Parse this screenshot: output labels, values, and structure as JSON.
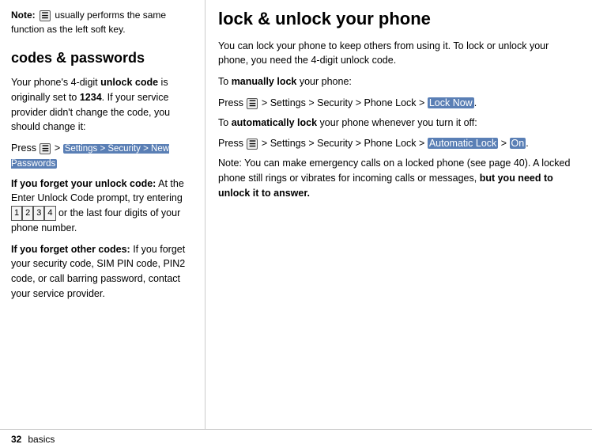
{
  "left": {
    "note": {
      "label": "Note:",
      "text": " usually performs the same function as the left soft key."
    },
    "section_title": "codes & passwords",
    "intro": "Your phone's 4-digit ",
    "intro_bold": "unlock code",
    "intro2": " is originally set to ",
    "intro2_bold": "1234",
    "intro3": ". If your service provider didn't change the code, you should change it:",
    "press_label": "Press",
    "menu_icon": "☰",
    "menu_path": "Settings > Security > New Passwords",
    "forget_code_label": "If you forget your unlock code:",
    "forget_code_text": " At the Enter Unlock Code prompt, try entering ",
    "digits": [
      "1",
      "2",
      "3",
      "4"
    ],
    "forget_code_text2": " or the last four digits of your phone number.",
    "forget_other_label": "If you forget other codes:",
    "forget_other_text": " If you forget your security code, SIM PIN code, PIN2 code, or call barring password, contact your service provider."
  },
  "right": {
    "title": "lock & unlock your phone",
    "intro": "You can lock your phone to keep others from using it. To lock or unlock your phone, you need the 4-digit unlock code.",
    "manual_lock_intro": "To ",
    "manual_lock_bold": "manually lock",
    "manual_lock_intro2": " your phone:",
    "press_label1": "Press",
    "menu_icon1": "☰",
    "menu_path1_pre": "Settings > Security > Phone Lock",
    "menu_path1_highlight": "Lock Now",
    "menu_path1_suffix": ".",
    "auto_lock_intro": "To ",
    "auto_lock_bold": "automatically lock",
    "auto_lock_intro2": " your phone whenever you turn it off:",
    "press_label2": "Press",
    "menu_icon2": "☰",
    "menu_path2_pre": "Settings > Security > Phone Lock",
    "menu_path2_highlight": "Automatic Lock",
    "menu_path2_mid": " > ",
    "menu_path2_highlight2": "On",
    "menu_path2_suffix": ".",
    "note_text1": "Note: You can make emergency calls on a locked phone (see page 40). A locked phone still rings or vibrates for incoming calls or messages, ",
    "note_bold": "but you need to unlock it to answer."
  },
  "footer": {
    "page_num": "32",
    "section": "basics"
  }
}
